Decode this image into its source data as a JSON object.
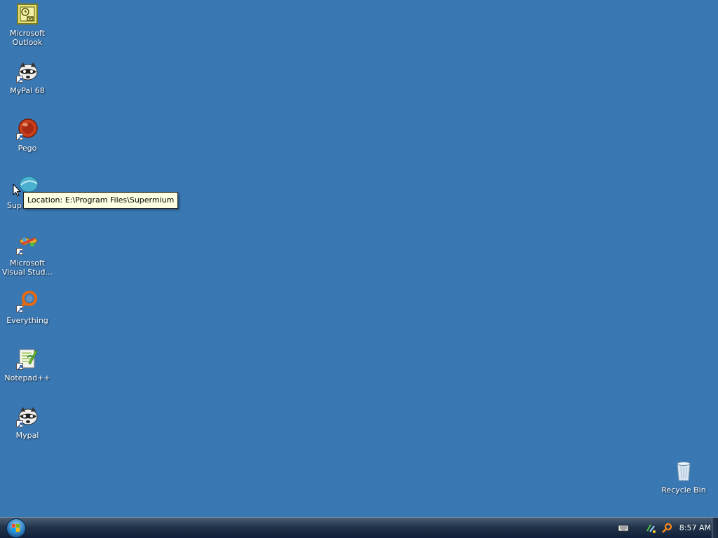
{
  "desktop": {
    "icons": [
      {
        "label": "Microsoft\nOutlook",
        "name": "microsoft-outlook-icon"
      },
      {
        "label": "MyPal 68",
        "name": "mypal-68-icon"
      },
      {
        "label": "Pego",
        "name": "pego-icon"
      },
      {
        "label": "Sup",
        "name": "supermium-icon"
      },
      {
        "label": "Microsoft\nVisual Stud...",
        "name": "microsoft-visual-studio-icon"
      },
      {
        "label": "Everything",
        "name": "everything-icon"
      },
      {
        "label": "Notepad++",
        "name": "notepad-plus-plus-icon"
      },
      {
        "label": "Mypal",
        "name": "mypal-icon"
      }
    ],
    "recycle_bin": {
      "label": "Recycle Bin"
    }
  },
  "tooltip": {
    "text": "Location: E:\\Program Files\\Supermium"
  },
  "taskbar": {
    "clock": "8:57 AM"
  },
  "colors": {
    "desktop_background": "#3a78b4",
    "tooltip_background": "#ffffe1"
  }
}
